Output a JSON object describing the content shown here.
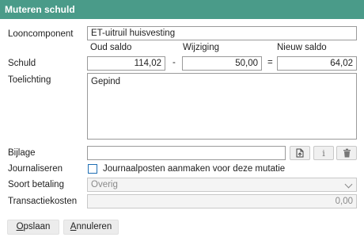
{
  "dialog": {
    "title": "Muteren schuld"
  },
  "looncomponent": {
    "label": "Looncomponent",
    "value": "ET-uitruil huisvesting"
  },
  "headers": {
    "oud": "Oud saldo",
    "wijziging": "Wijziging",
    "nieuw": "Nieuw saldo"
  },
  "schuld": {
    "label": "Schuld",
    "oud_saldo": "114,02",
    "minus": "-",
    "wijziging": "50,00",
    "equals": "=",
    "nieuw_saldo": "64,02"
  },
  "toelichting": {
    "label": "Toelichting",
    "value": "Gepind"
  },
  "bijlage": {
    "label": "Bijlage",
    "value": ""
  },
  "journaliseren": {
    "label": "Journaliseren",
    "checkbox_label": "Journaalposten aanmaken voor deze mutatie",
    "checked": false
  },
  "soort_betaling": {
    "label": "Soort betaling",
    "value": "Overig"
  },
  "transactiekosten": {
    "label": "Transactiekosten",
    "value": "0,00"
  },
  "buttons": {
    "save_first": "O",
    "save_rest": "pslaan",
    "cancel_first": "A",
    "cancel_rest": "nnuleren"
  },
  "icons": {
    "attach": "attach-file-icon",
    "info": "info-icon",
    "delete": "trash-icon"
  }
}
